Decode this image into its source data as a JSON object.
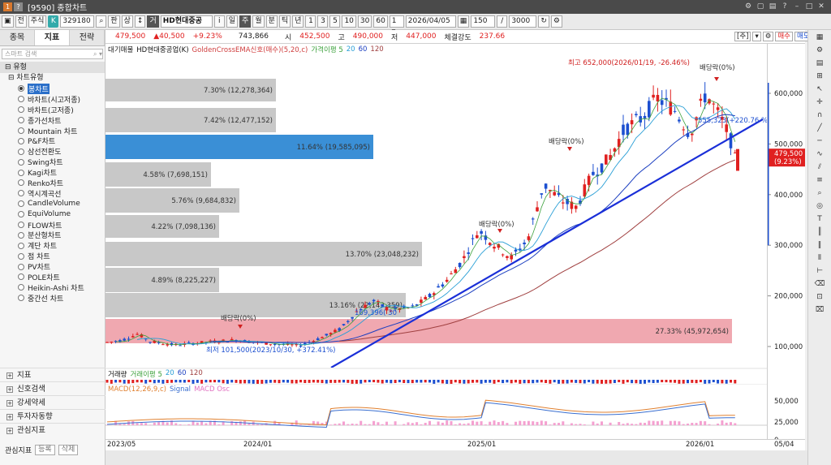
{
  "window": {
    "title": "[9590] 종합차트",
    "icon_a": "1",
    "icon_b": "?"
  },
  "toolbar": {
    "btn_prev": "전",
    "btn_type": "주식",
    "k_badge": "K",
    "code": "329180",
    "btn_pan": "판",
    "btn_sang": "상",
    "ga_badge": "거",
    "stock_name": "HD현대중공",
    "btn_i": "i",
    "periods": [
      "일",
      "주",
      "월",
      "분",
      "틱",
      "년"
    ],
    "active_period": "주",
    "minutes": [
      "1",
      "3",
      "5",
      "10",
      "30",
      "60"
    ],
    "date_value": "2026/04/05",
    "count_value": "150",
    "max_value": "3000"
  },
  "pricebar": {
    "price": "479,500",
    "change": "▲40,500",
    "change_pct": "+9.23%",
    "volume": "743,866",
    "open_label": "시",
    "open": "452,500",
    "high_label": "고",
    "high": "490,000",
    "low_label": "저",
    "low": "447,000",
    "strength_label": "체결강도",
    "strength": "237.66",
    "btn_ju": "[주]",
    "btn_buy": "매수",
    "btn_sell": "매도"
  },
  "left_panel": {
    "tabs": [
      "종목",
      "지표",
      "전략"
    ],
    "active_tab": "지표",
    "search_placeholder": "스마트 검색",
    "section_type": "유형",
    "tree_parent": "차트유형",
    "chart_types": [
      "봉차트",
      "바차트(시고저종)",
      "바차트(고저종)",
      "종가선차트",
      "Mountain 차트",
      "P&F차트",
      "삼선전환도",
      "Swing차트",
      "Kagi차트",
      "Renko차트",
      "역시계곡선",
      "CandleVolume",
      "EquiVolume",
      "FLOW차트",
      "분산형차트",
      "계단 차트",
      "점 차트",
      "PV차트",
      "POLE차트",
      "Heikin-Ashi 차트",
      "중간선 차트"
    ],
    "selected_type": "봉차트",
    "bottom_items": [
      "지표",
      "신호검색",
      "강세약세",
      "투자자동향",
      "관심지표"
    ],
    "footer_label": "관심지표",
    "footer_btn_reg": "등록",
    "footer_btn_del": "삭제"
  },
  "legend": {
    "items": [
      "대기매물",
      "HD현대중공업(K)",
      "GoldenCrossEMA신호(매수)(5,20,c)",
      "가격이평 5",
      "20",
      "60",
      "120"
    ],
    "colors": [
      "#222222",
      "#111111",
      "#d04040",
      "#3aa03a",
      "#2a9fd6",
      "#1c3fc0",
      "#a04040"
    ]
  },
  "volume_profile": [
    {
      "label": "7.30% (12,278,364)",
      "highlight": false
    },
    {
      "label": "7.42% (12,477,152)",
      "highlight": false
    },
    {
      "label": "11.64% (19,585,095)",
      "highlight": true
    },
    {
      "label": "4.58% (7,698,151)",
      "highlight": false
    },
    {
      "label": "5.76% (9,684,832)",
      "highlight": false
    },
    {
      "label": "4.22% (7,098,136)",
      "highlight": false
    },
    {
      "label": "13.70% (23,048,232)",
      "highlight": false
    },
    {
      "label": "4.89% (8,225,227)",
      "highlight": false
    },
    {
      "label": "13.16% (22,143,359)",
      "highlight": false
    },
    {
      "label": "27.33% (45,972,654)",
      "highlight": "red"
    }
  ],
  "annotations": {
    "max": "최고 652,000(2026/01/19, -26.46%)",
    "min": "최저 101,500(2023/10/30, +372.41%)",
    "dividend": "배당락(0%)",
    "trend_label_1": "169,396( 30",
    "trend_label_2": "555,323(+220.76 %)"
  },
  "y_axis": {
    "ticks": [
      "600,000",
      "500,000",
      "400,000",
      "300,000",
      "200,000",
      "100,000"
    ],
    "current_price": "479,500",
    "current_pct": "(9.23%)"
  },
  "volume_legend": {
    "items": [
      "거래량",
      "거래이평 5",
      "20",
      "60",
      "120"
    ],
    "colors": [
      "#111111",
      "#3aa03a",
      "#2a9fd6",
      "#1c3fc0",
      "#a04040"
    ]
  },
  "macd_legend": {
    "items": [
      "MACD(12,26,9,c)",
      "Signal",
      "MACD Osc"
    ],
    "colors": [
      "#e08030",
      "#3a6fd0",
      "#e070c0"
    ]
  },
  "macd_axis": {
    "ticks": [
      "50,000",
      "25,000",
      "0"
    ]
  },
  "x_axis": {
    "ticks": [
      "2023/05",
      "2024/01",
      "2025/01",
      "2026/01"
    ],
    "end_label": "05/04"
  },
  "colors": {
    "up": "#e02020",
    "down": "#1c4fd0",
    "trend": "#1a2fd8",
    "profile_gray": "#c8c8c8",
    "profile_blue": "#3a8fd6",
    "profile_red": "#f0a8b0"
  }
}
